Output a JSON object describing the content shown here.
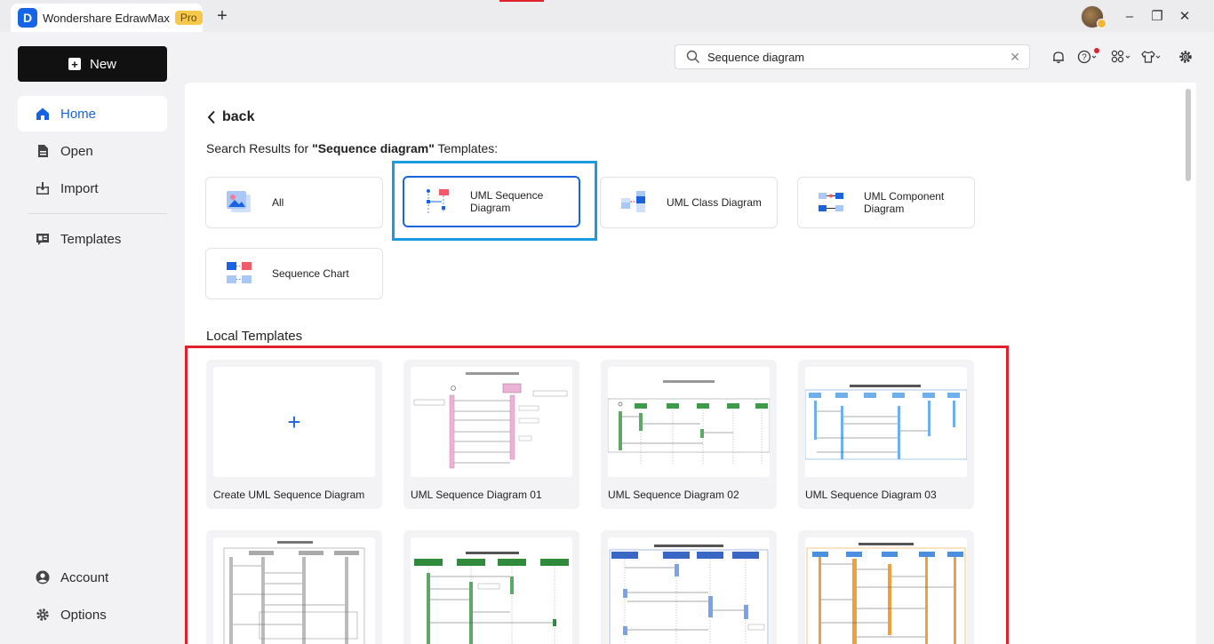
{
  "app": {
    "logo_letter": "D",
    "name": "Wondershare EdrawMax",
    "badge": "Pro",
    "new_tab": "+"
  },
  "window": {
    "minimize": "–",
    "maximize": "❐",
    "close": "✕"
  },
  "sidebar": {
    "new_label": "New",
    "items": [
      {
        "label": "Home",
        "icon": "home-icon"
      },
      {
        "label": "Open",
        "icon": "file-icon"
      },
      {
        "label": "Import",
        "icon": "import-icon"
      },
      {
        "label": "Templates",
        "icon": "templates-icon"
      }
    ],
    "bottom": [
      {
        "label": "Account",
        "icon": "account-icon"
      },
      {
        "label": "Options",
        "icon": "gear-icon"
      }
    ]
  },
  "search": {
    "value": "Sequence diagram",
    "clear": "✕"
  },
  "main": {
    "back_label": "back",
    "results_prefix": "Search Results for ",
    "results_query": "\"Sequence diagram\"",
    "results_suffix": " Templates:",
    "categories": [
      {
        "label": "All"
      },
      {
        "label_line1": "UML Sequence",
        "label_line2": "Diagram"
      },
      {
        "label": "UML Class Diagram"
      },
      {
        "label_line1": "UML Component",
        "label_line2": "Diagram"
      },
      {
        "label": "Sequence Chart"
      }
    ],
    "local_title": "Local Templates",
    "cards": [
      {
        "caption": "Create UML Sequence Diagram",
        "plus": "+"
      },
      {
        "caption": "UML Sequence Diagram 01"
      },
      {
        "caption": "UML Sequence Diagram 02"
      },
      {
        "caption": "UML Sequence Diagram 03"
      }
    ]
  },
  "colors": {
    "accent": "#1a63e0",
    "highlight_red": "#e0202a",
    "highlight_blue": "#1a9be0"
  }
}
